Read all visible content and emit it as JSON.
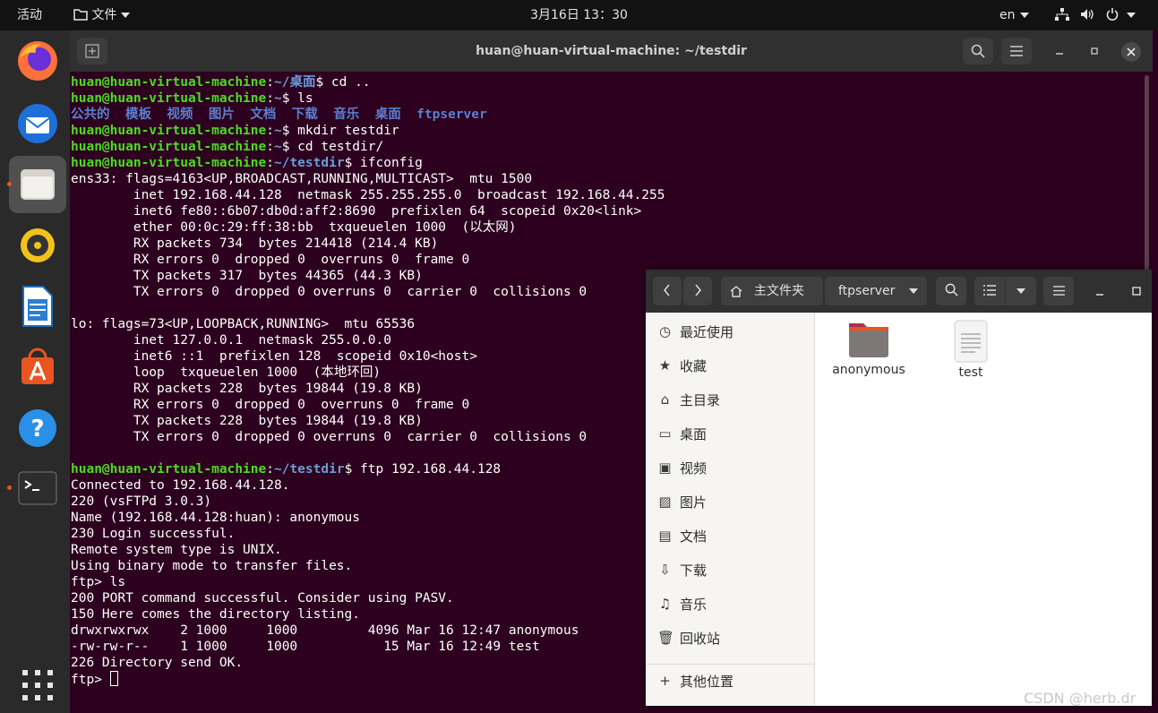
{
  "topbar": {
    "activities": "活动",
    "files_menu": "文件",
    "clock": "3月16日 13：30",
    "language": "en"
  },
  "dock": {
    "apps": [
      "firefox-icon",
      "thunderbird-icon",
      "files-icon",
      "rhythmbox-icon",
      "writer-icon",
      "software-icon",
      "help-icon",
      "terminal-icon",
      "app-grid-icon"
    ]
  },
  "terminal": {
    "title": "huan@huan-virtual-machine: ~/testdir",
    "lines": [
      [
        [
          "pu",
          "huan@huan-virtual-machine"
        ],
        [
          "n",
          ":"
        ],
        [
          "pp",
          "~/桌面"
        ],
        [
          "n",
          "$ cd .."
        ]
      ],
      [
        [
          "pu",
          "huan@huan-virtual-machine"
        ],
        [
          "n",
          ":"
        ],
        [
          "pp",
          "~"
        ],
        [
          "n",
          "$ ls"
        ]
      ],
      [
        [
          "dirs",
          "公共的  模板  视频  图片  文档  下载  音乐  桌面  ftpserver"
        ]
      ],
      [
        [
          "pu",
          "huan@huan-virtual-machine"
        ],
        [
          "n",
          ":"
        ],
        [
          "pp",
          "~"
        ],
        [
          "n",
          "$ mkdir testdir"
        ]
      ],
      [
        [
          "pu",
          "huan@huan-virtual-machine"
        ],
        [
          "n",
          ":"
        ],
        [
          "pp",
          "~"
        ],
        [
          "n",
          "$ cd testdir/"
        ]
      ],
      [
        [
          "pu",
          "huan@huan-virtual-machine"
        ],
        [
          "n",
          ":"
        ],
        [
          "pp",
          "~/testdir"
        ],
        [
          "n",
          "$ ifconfig"
        ]
      ],
      [
        [
          "n",
          "ens33: flags=4163<UP,BROADCAST,RUNNING,MULTICAST>  mtu 1500"
        ]
      ],
      [
        [
          "n",
          "        inet 192.168.44.128  netmask 255.255.255.0  broadcast 192.168.44.255"
        ]
      ],
      [
        [
          "n",
          "        inet6 fe80::6b07:db0d:aff2:8690  prefixlen 64  scopeid 0x20<link>"
        ]
      ],
      [
        [
          "n",
          "        ether 00:0c:29:ff:38:bb  txqueuelen 1000  (以太网)"
        ]
      ],
      [
        [
          "n",
          "        RX packets 734  bytes 214418 (214.4 KB)"
        ]
      ],
      [
        [
          "n",
          "        RX errors 0  dropped 0  overruns 0  frame 0"
        ]
      ],
      [
        [
          "n",
          "        TX packets 317  bytes 44365 (44.3 KB)"
        ]
      ],
      [
        [
          "n",
          "        TX errors 0  dropped 0 overruns 0  carrier 0  collisions 0"
        ]
      ],
      [
        [
          "n",
          ""
        ]
      ],
      [
        [
          "n",
          "lo: flags=73<UP,LOOPBACK,RUNNING>  mtu 65536"
        ]
      ],
      [
        [
          "n",
          "        inet 127.0.0.1  netmask 255.0.0.0"
        ]
      ],
      [
        [
          "n",
          "        inet6 ::1  prefixlen 128  scopeid 0x10<host>"
        ]
      ],
      [
        [
          "n",
          "        loop  txqueuelen 1000  (本地环回)"
        ]
      ],
      [
        [
          "n",
          "        RX packets 228  bytes 19844 (19.8 KB)"
        ]
      ],
      [
        [
          "n",
          "        RX errors 0  dropped 0  overruns 0  frame 0"
        ]
      ],
      [
        [
          "n",
          "        TX packets 228  bytes 19844 (19.8 KB)"
        ]
      ],
      [
        [
          "n",
          "        TX errors 0  dropped 0 overruns 0  carrier 0  collisions 0"
        ]
      ],
      [
        [
          "n",
          ""
        ]
      ],
      [
        [
          "pu",
          "huan@huan-virtual-machine"
        ],
        [
          "n",
          ":"
        ],
        [
          "pp",
          "~/testdir"
        ],
        [
          "n",
          "$ ftp 192.168.44.128"
        ]
      ],
      [
        [
          "n",
          "Connected to 192.168.44.128."
        ]
      ],
      [
        [
          "n",
          "220 (vsFTPd 3.0.3)"
        ]
      ],
      [
        [
          "n",
          "Name (192.168.44.128:huan): anonymous"
        ]
      ],
      [
        [
          "n",
          "230 Login successful."
        ]
      ],
      [
        [
          "n",
          "Remote system type is UNIX."
        ]
      ],
      [
        [
          "n",
          "Using binary mode to transfer files."
        ]
      ],
      [
        [
          "n",
          "ftp> ls"
        ]
      ],
      [
        [
          "n",
          "200 PORT command successful. Consider using PASV."
        ]
      ],
      [
        [
          "n",
          "150 Here comes the directory listing."
        ]
      ],
      [
        [
          "n",
          "drwxrwxrwx    2 1000     1000         4096 Mar 16 12:47 anonymous"
        ]
      ],
      [
        [
          "n",
          "-rw-rw-r--    1 1000     1000           15 Mar 16 12:49 test"
        ]
      ],
      [
        [
          "n",
          "226 Directory send OK."
        ]
      ],
      [
        [
          "n",
          "ftp> "
        ]
      ]
    ]
  },
  "file_manager": {
    "breadcrumb_home": "主文件夹",
    "breadcrumb_current": "ftpserver",
    "sidebar": [
      {
        "label": "最近使用",
        "icon": "recent-icon",
        "glyph": "◷"
      },
      {
        "label": "收藏",
        "icon": "star-icon",
        "glyph": "★"
      },
      {
        "label": "主目录",
        "icon": "home-icon",
        "glyph": "⌂"
      },
      {
        "label": "桌面",
        "icon": "desktop-icon",
        "glyph": "▭"
      },
      {
        "label": "视频",
        "icon": "video-icon",
        "glyph": "▣"
      },
      {
        "label": "图片",
        "icon": "image-icon",
        "glyph": "▨"
      },
      {
        "label": "文档",
        "icon": "document-icon",
        "glyph": "▤"
      },
      {
        "label": "下载",
        "icon": "download-icon",
        "glyph": "⇩"
      },
      {
        "label": "音乐",
        "icon": "music-icon",
        "glyph": "♫"
      },
      {
        "label": "回收站",
        "icon": "trash-icon",
        "glyph": "🗑"
      }
    ],
    "other_locations": "其他位置",
    "files": [
      {
        "name": "anonymous",
        "type": "folder"
      },
      {
        "name": "test",
        "type": "text-file"
      }
    ]
  },
  "watermark": "CSDN @herb.dr",
  "colors": {
    "terminal_bg": "#2c001e",
    "prompt_user": "#4fda23",
    "prompt_path": "#6e9bd6",
    "accent": "#e95420"
  }
}
